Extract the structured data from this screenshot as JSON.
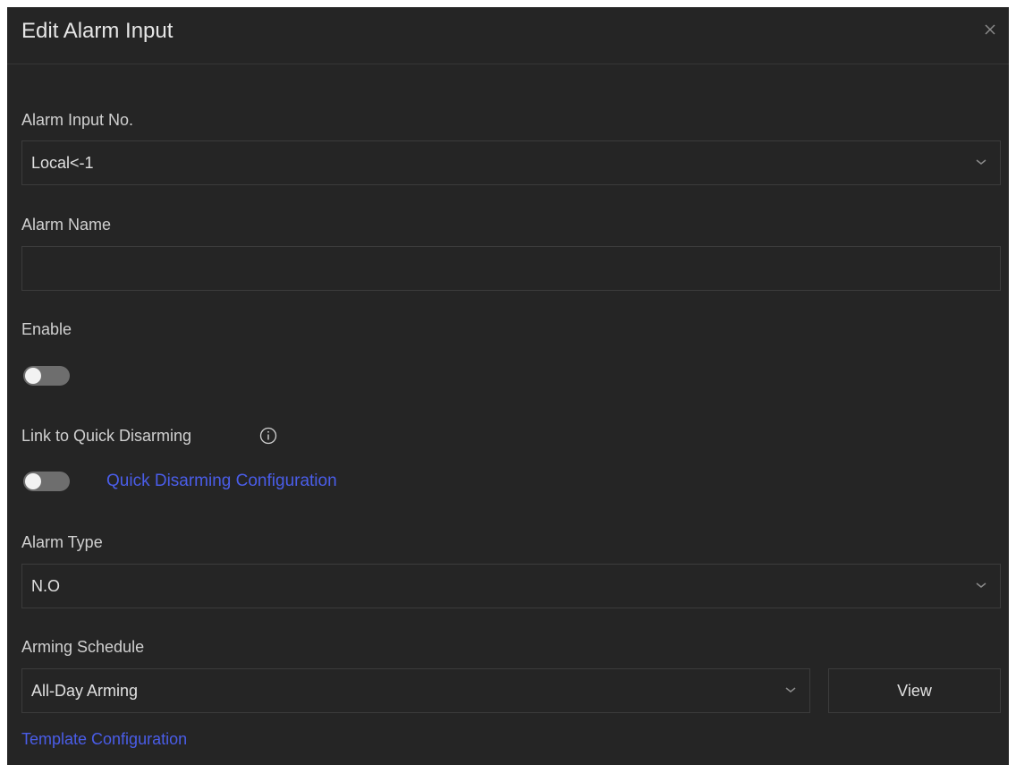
{
  "dialog": {
    "title": "Edit Alarm Input",
    "close_icon": "close-icon"
  },
  "alarm_input_no": {
    "label": "Alarm Input No.",
    "value": "Local<-1"
  },
  "alarm_name": {
    "label": "Alarm Name",
    "value": ""
  },
  "enable": {
    "label": "Enable",
    "on": false
  },
  "quick_disarming": {
    "label": "Link to Quick Disarming",
    "info_icon": "info-icon",
    "on": false,
    "config_link": "Quick Disarming Configuration"
  },
  "alarm_type": {
    "label": "Alarm Type",
    "value": "N.O"
  },
  "arming_schedule": {
    "label": "Arming Schedule",
    "value": "All-Day Arming",
    "view_button": "View",
    "template_link": "Template Configuration"
  },
  "colors": {
    "background": "#252525",
    "border": "#3c3c3c",
    "link": "#4a5de8",
    "toggle_off": "#6e6e6e"
  }
}
